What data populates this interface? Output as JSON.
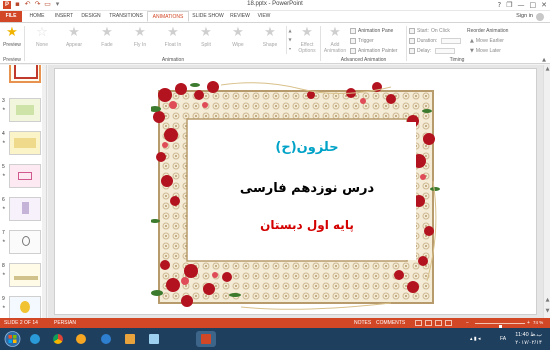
{
  "window": {
    "title": "18.pptx - PowerPoint",
    "app_logo": "P",
    "qat": [
      "save-icon",
      "undo-icon",
      "redo-icon",
      "start-from-beginning-icon",
      "customize-icon"
    ],
    "controls": {
      "help": "?",
      "restore": "❐",
      "minimize": "—",
      "maximize": "□",
      "close": "✕"
    }
  },
  "tabs": [
    {
      "label": "FILE"
    },
    {
      "label": "HOME"
    },
    {
      "label": "INSERT"
    },
    {
      "label": "DESIGN"
    },
    {
      "label": "TRANSITIONS"
    },
    {
      "label": "ANIMATIONS"
    },
    {
      "label": "SLIDE SHOW"
    },
    {
      "label": "REVIEW"
    },
    {
      "label": "VIEW"
    }
  ],
  "active_tab": "ANIMATIONS",
  "user": {
    "name": "Sign in"
  },
  "ribbon": {
    "preview": {
      "label": "Preview",
      "icon": "star-preview-icon"
    },
    "animations": [
      {
        "label": "None"
      },
      {
        "label": "Appear"
      },
      {
        "label": "Fade"
      },
      {
        "label": "Fly In"
      },
      {
        "label": "Float In"
      },
      {
        "label": "Split"
      },
      {
        "label": "Wipe"
      },
      {
        "label": "Shape"
      }
    ],
    "effect_options": {
      "label": "Effect Options",
      "arrow": "▾"
    },
    "add_animation": {
      "label": "Add Animation",
      "arrow": "▾"
    },
    "animation_pane": "Animation Pane",
    "trigger": "Trigger",
    "animation_painter": "Animation Painter",
    "start": {
      "label": "Start:",
      "value": "On Click"
    },
    "duration": {
      "label": "Duration:"
    },
    "delay": {
      "label": "Delay:"
    },
    "reorder_title": "Reorder Animation",
    "move_earlier": "Move Earlier",
    "move_later": "Move Later",
    "groups": {
      "preview": "Preview",
      "animation": "Animation",
      "advanced": "Advanced Animation",
      "timing": "Timing"
    }
  },
  "thumbnails": [
    {
      "number": "",
      "star": "★"
    },
    {
      "number": "3",
      "star": "★"
    },
    {
      "number": "4",
      "star": "★"
    },
    {
      "number": "5",
      "star": "★"
    },
    {
      "number": "6",
      "star": "★"
    },
    {
      "number": "7",
      "star": "★"
    },
    {
      "number": "8",
      "star": "★"
    },
    {
      "number": "9",
      "star": "★"
    }
  ],
  "slide": {
    "title": "حلزون(ح)",
    "line2": "درس نوزدهم فارسی",
    "line3": "پایه اول دبستان",
    "colors": {
      "title": "#00a3c7",
      "line2": "#000000",
      "line3": "#d40000"
    }
  },
  "status": {
    "slide": "SLIDE 2 OF 14",
    "language": "PERSIAN",
    "notes": "NOTES",
    "comments": "COMMENTS",
    "zoom": "74 %",
    "zoom_level": 0.74
  },
  "taskbar": {
    "apps": [
      "start-icon",
      "ie-icon",
      "chrome-icon",
      "media-player-icon",
      "firefox-icon",
      "file-explorer-icon",
      "powerpoint-icon",
      "paint-icon"
    ],
    "tray_lang": "FA",
    "clock_time": "11:40 ب.ظ",
    "clock_date": "۲۰۱۷/۰۲/۱۴"
  }
}
